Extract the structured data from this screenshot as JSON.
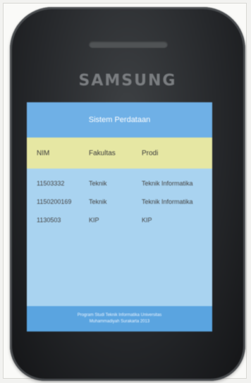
{
  "device": {
    "brand": "SAMSUNG"
  },
  "app": {
    "title": "Sistem Perdataan"
  },
  "table": {
    "headers": [
      "NIM",
      "Fakultas",
      "Prodi"
    ],
    "rows": [
      [
        "11503332",
        "Teknik",
        "Teknik Informatika"
      ],
      [
        "1150200169",
        "Teknik",
        "Teknik Informatika"
      ],
      [
        "1130503",
        "KIP",
        "KIP"
      ]
    ]
  },
  "footer": {
    "line1": "Program Studi Teknik Informatika Universitas",
    "line2": "Muhammadiyah Surakarta 2013"
  }
}
